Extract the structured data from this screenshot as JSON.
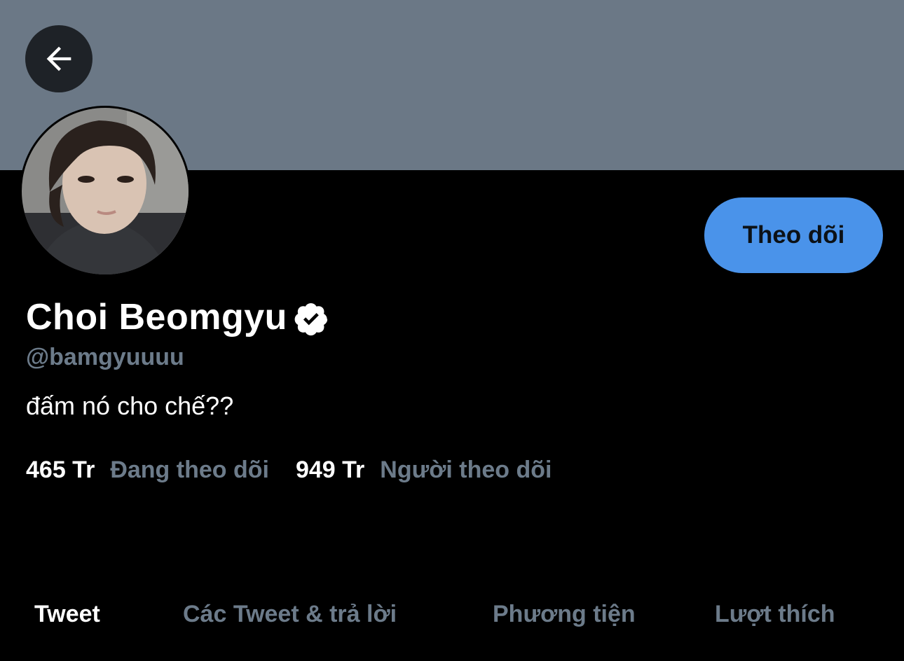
{
  "header": {
    "banner_color": "#6b7886"
  },
  "profile": {
    "display_name": "Choi Beomgyu",
    "verified": true,
    "handle": "@bamgyuuuu",
    "bio": "đấm nó cho chế??",
    "follow_label": "Theo dõi",
    "accent_color": "#4a93ea"
  },
  "stats": {
    "following_count": "465 Tr",
    "following_label": "Đang theo dõi",
    "followers_count": "949 Tr",
    "followers_label": "Người theo dõi"
  },
  "tabs": [
    {
      "label": "Tweet",
      "active": true
    },
    {
      "label": "Các Tweet & trả lời",
      "active": false
    },
    {
      "label": "Phương tiện",
      "active": false
    },
    {
      "label": "Lượt thích",
      "active": false
    }
  ],
  "icons": [
    "arrow-left-icon",
    "verified-badge-icon"
  ]
}
